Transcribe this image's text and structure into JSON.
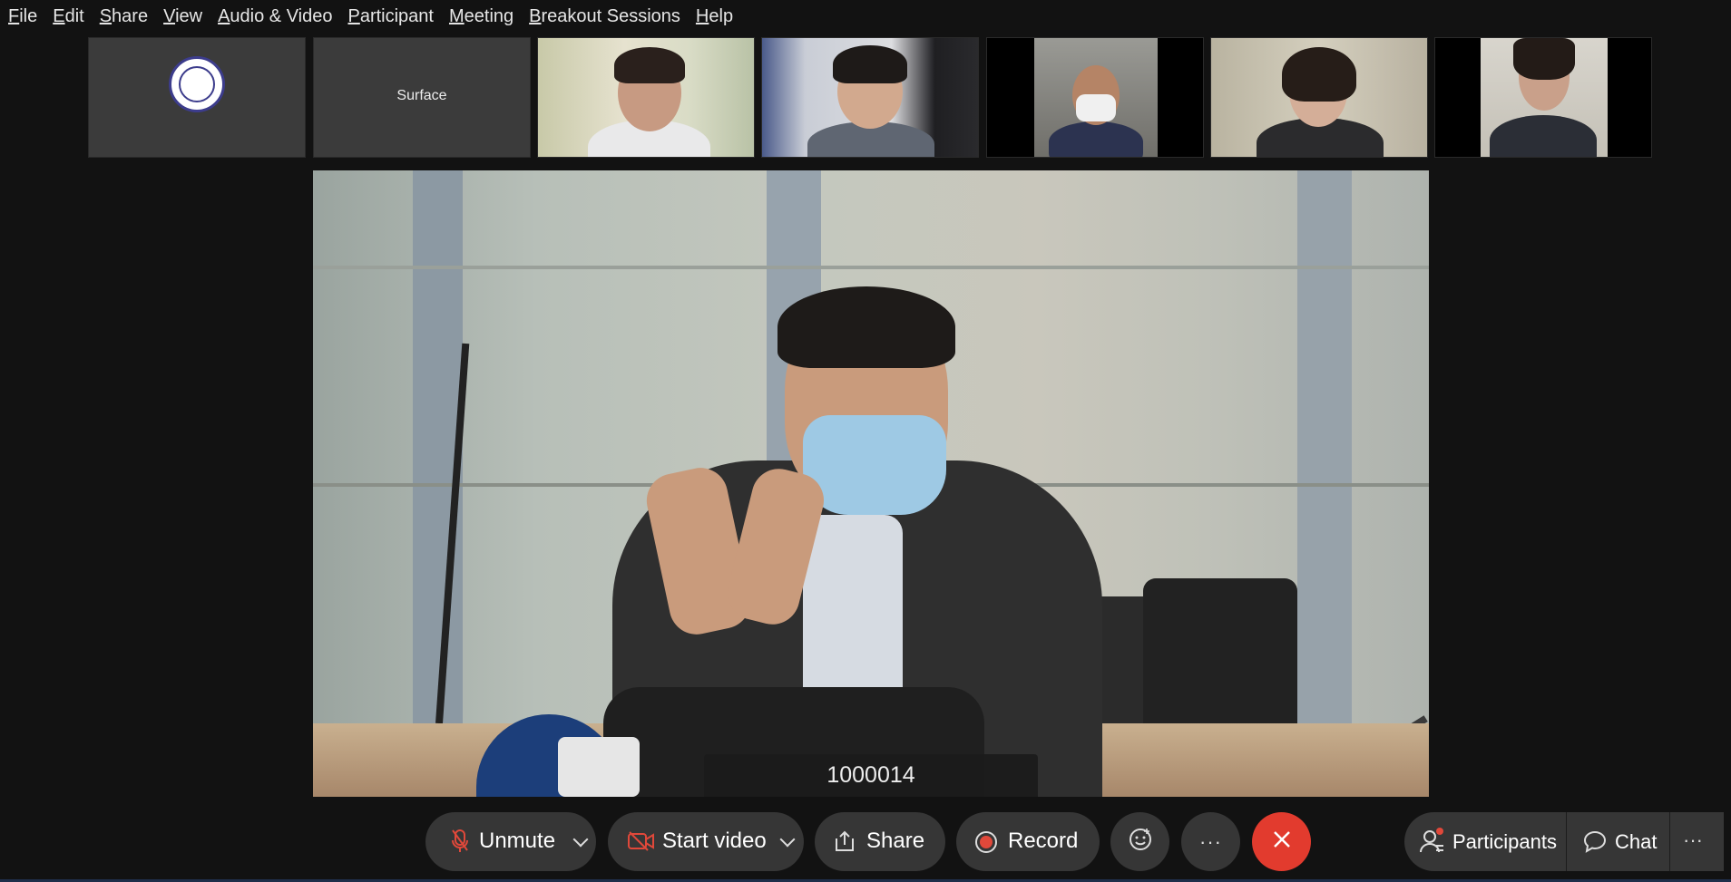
{
  "menu": {
    "items": [
      {
        "label": "File",
        "underline": "F",
        "rest": "ile"
      },
      {
        "label": "Edit",
        "underline": "E",
        "rest": "dit"
      },
      {
        "label": "Share",
        "underline": "S",
        "rest": "hare"
      },
      {
        "label": "View",
        "underline": "V",
        "rest": "iew"
      },
      {
        "label": "Audio & Video",
        "underline": "A",
        "rest": "udio & Video"
      },
      {
        "label": "Participant",
        "underline": "P",
        "rest": "articipant"
      },
      {
        "label": "Meeting",
        "underline": "M",
        "rest": "eeting"
      },
      {
        "label": "Breakout Sessions",
        "underline": "B",
        "rest": "reakout Sessions"
      },
      {
        "label": "Help",
        "underline": "H",
        "rest": "elp"
      }
    ]
  },
  "thumbnails": {
    "surface_name": "Surface"
  },
  "main_video": {
    "participant_label": "1000014"
  },
  "toolbar": {
    "unmute_label": "Unmute",
    "start_video_label": "Start video",
    "share_label": "Share",
    "record_label": "Record",
    "participants_label": "Participants",
    "chat_label": "Chat",
    "more_glyph": "···"
  },
  "colors": {
    "background": "#121212",
    "button": "#363636",
    "end_button": "#e23b2e",
    "muted_icon": "#e0483a",
    "record_dot": "#e0483a"
  }
}
